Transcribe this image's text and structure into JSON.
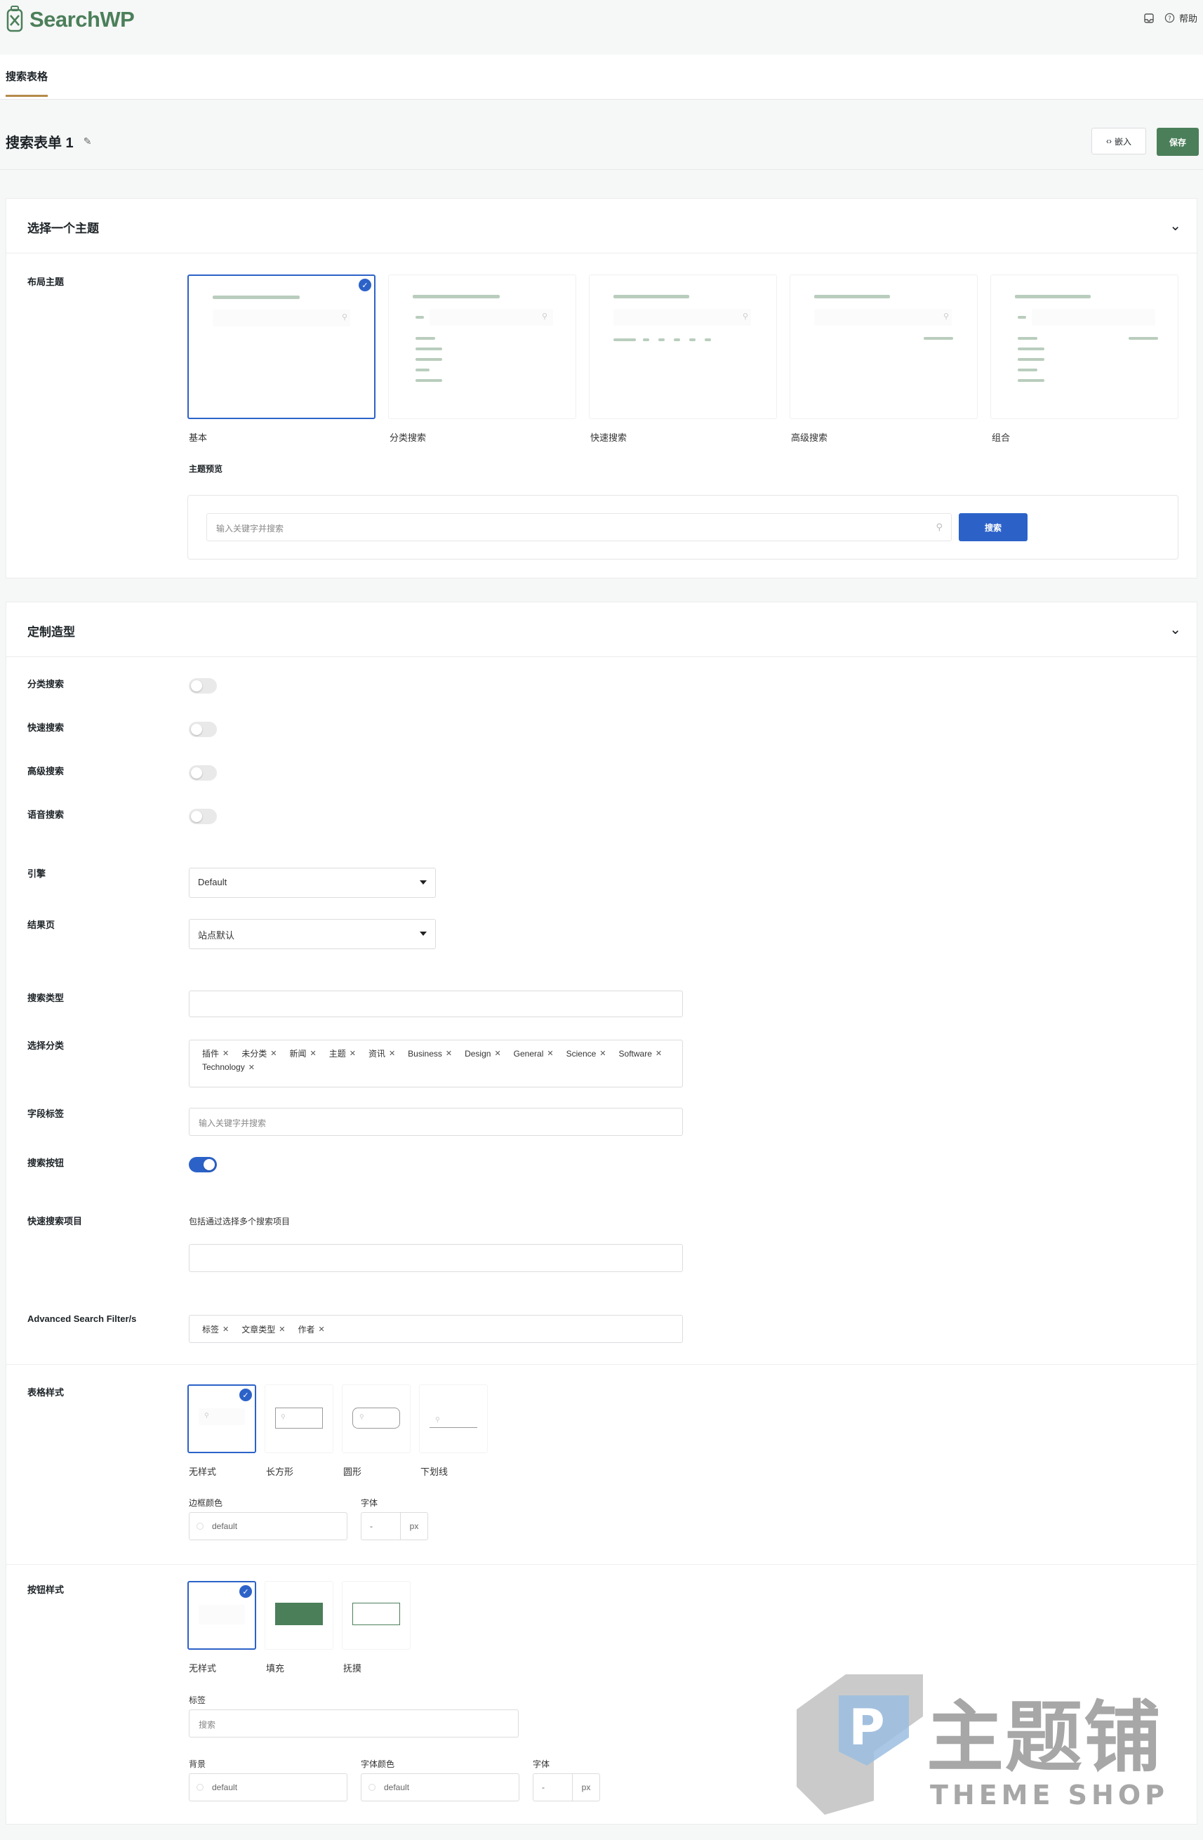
{
  "app": {
    "name": "SearchWP"
  },
  "topbar": {
    "help_label": "帮助"
  },
  "tabs": [
    {
      "label": "搜索表格"
    }
  ],
  "form": {
    "title": "搜索表单 1",
    "embed_label": "嵌入",
    "save_label": "保存"
  },
  "theme_section": {
    "title": "选择一个主题",
    "layout_label": "布局主题",
    "themes": [
      {
        "name": "基本",
        "selected": true
      },
      {
        "name": "分类搜索",
        "selected": false
      },
      {
        "name": "快速搜索",
        "selected": false
      },
      {
        "name": "高级搜索",
        "selected": false
      },
      {
        "name": "组合",
        "selected": false
      }
    ],
    "preview_label": "主题预览",
    "preview_placeholder": "输入关键字并搜索",
    "preview_button": "搜索"
  },
  "custom_section": {
    "title": "定制造型",
    "toggles": [
      {
        "label": "分类搜索",
        "on": false
      },
      {
        "label": "快速搜索",
        "on": false
      },
      {
        "label": "高级搜索",
        "on": false
      },
      {
        "label": "语音搜索",
        "on": false
      }
    ],
    "engine": {
      "label": "引擎",
      "value": "Default"
    },
    "results_page": {
      "label": "结果页",
      "value": "站点默认"
    },
    "search_type": {
      "label": "搜索类型",
      "value": ""
    },
    "categories": {
      "label": "选择分类",
      "chips": [
        "插件",
        "未分类",
        "新闻",
        "主题",
        "资讯",
        "Business",
        "Design",
        "General",
        "Science",
        "Software",
        "Technology"
      ]
    },
    "field_label": {
      "label": "字段标签",
      "placeholder": "输入关键字并搜索"
    },
    "search_button": {
      "label": "搜索按钮",
      "on": true
    },
    "quick_items": {
      "label": "快速搜索项目",
      "hint": "包括通过选择多个搜索项目"
    },
    "advanced_filters": {
      "label": "Advanced Search Filter/s",
      "chips": [
        "标签",
        "文章类型",
        "作者"
      ]
    },
    "form_style": {
      "label": "表格样式",
      "options": [
        {
          "name": "无样式",
          "selected": true
        },
        {
          "name": "长方形",
          "selected": false
        },
        {
          "name": "圆形",
          "selected": false
        },
        {
          "name": "下划线",
          "selected": false
        }
      ],
      "border_color_label": "边框颜色",
      "border_color_value": "default",
      "font_label": "字体",
      "font_value": "-",
      "font_unit": "px"
    },
    "button_style": {
      "label": "按钮样式",
      "options": [
        {
          "name": "无样式",
          "selected": true
        },
        {
          "name": "填充",
          "selected": false
        },
        {
          "name": "抚摸",
          "selected": false
        }
      ],
      "button_label_label": "标签",
      "button_label_value": "搜索",
      "bg_label": "背景",
      "bg_value": "default",
      "font_color_label": "字体颜色",
      "font_color_value": "default",
      "font_label": "字体",
      "font_value": "-",
      "font_unit": "px"
    }
  },
  "watermark": {
    "text_cn": "主题铺",
    "text_en": "THEME SHOP"
  },
  "colors": {
    "accent": "#2c62c8",
    "brand": "#4b7f5a",
    "tab_underline": "#b58a4a"
  }
}
